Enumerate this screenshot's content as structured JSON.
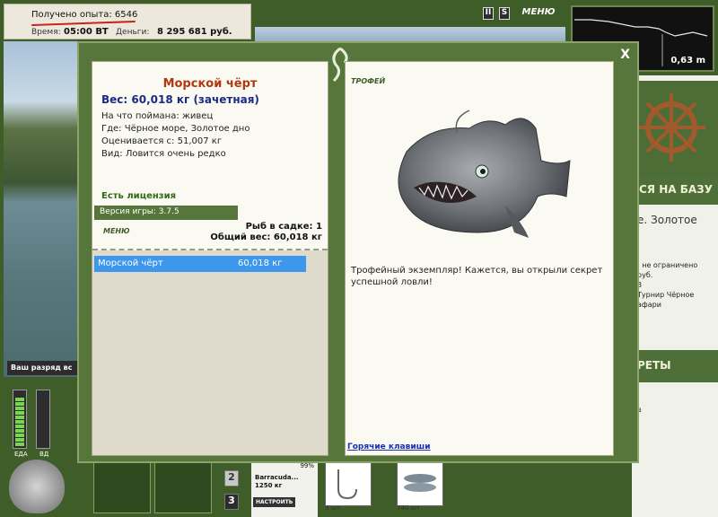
{
  "hud": {
    "xp_text": "Получено опыта: 6546",
    "time_label": "Время:",
    "time_value": "05:00 ВТ",
    "money_label": "Деньги:",
    "money_value": "8 295 681 руб.",
    "rank_text": "Ваш разряд вс",
    "menu_label": "МЕНЮ",
    "pause_label": "II",
    "sound_label": "S",
    "depth_value": "0,63 m",
    "food_label": "ЕДА",
    "bait_label": "ВД"
  },
  "right_panel": {
    "go_to_base": "СЯ НА БАЗУ",
    "location": "е. Золотое",
    "info_lines": [
      ": не ограничено",
      "руб.",
      "3",
      "Турнир Чёрное",
      "афари"
    ],
    "secrets": "РЕТЫ",
    "small_text": "в"
  },
  "tackle": {
    "percent": "99%",
    "name_line1": "Barracuda...",
    "name_line2": "1250 кг",
    "setup_label": "НАСТРОИТЬ",
    "slot2": "2",
    "slot3": "3",
    "hook_count": "3 шт.",
    "bait_count": "740 шт."
  },
  "dialog": {
    "close_label": "X",
    "fish": {
      "name": "Морской чёрт",
      "weight_line": "Вес: 60,018 кг (зачетная)",
      "caught_on": "На что поймана: живец",
      "where": "Где: Чёрное море, Золотое дно",
      "valued": "Оценивается с: 51,007 кг",
      "kind": "Вид: Ловится очень редко"
    },
    "license": "Есть лицензия",
    "version": "Версия игры: 3.7.5",
    "menu_label": "МЕНЮ",
    "cage_count": "Рыб в садке: 1",
    "total_weight": "Общий вес: 60,018 кг",
    "catch_list": [
      {
        "name": "Морской чёрт",
        "weight": "60,018 кг"
      }
    ],
    "trophy_label": "ТРОФЕЙ",
    "trophy_text": "Трофейный экземпляр! Кажется, вы открыли секрет успешной ловли!",
    "hotkeys": "Горячие клавиши"
  },
  "colors": {
    "panel_green": "#57763b",
    "fish_name": "#b0380e",
    "weight_blue": "#1b2a86",
    "selection_blue": "#3d97ec"
  }
}
